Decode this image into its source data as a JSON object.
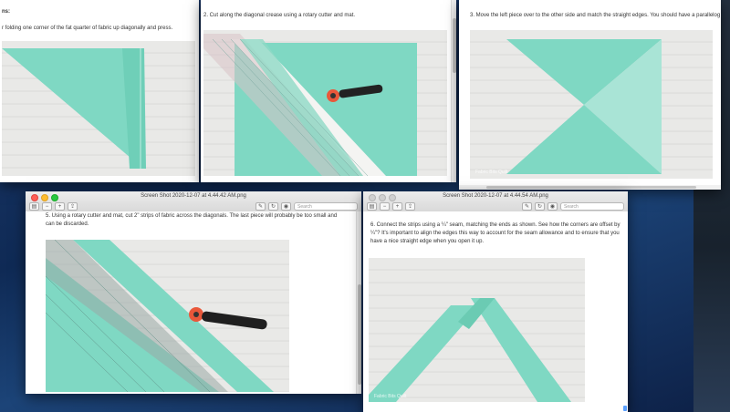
{
  "windows": {
    "w1": {
      "cap": "r folding one corner of the fat quarter of fabric up diagonally and press.",
      "head": "ns:"
    },
    "w2": {
      "cap": "2. Cut along the diagonal crease using a rotary cutter and mat."
    },
    "w3": {
      "cap": "3. Move the left piece over to the other side and match the straight edges. You should have a parallelog",
      "wm": "Fabric Bits Quilt"
    },
    "w4": {
      "title": "Screen Shot 2020-12-07 at 4.44.42 AM.png",
      "cap": "5. Using a rotary cutter and mat, cut 2\" strips of fabric across the diagonals. The last piece will probably be too small and can be discarded.",
      "search": "Search"
    },
    "w5": {
      "title": "Screen Shot 2020-12-07 at 4.44.54 AM.png",
      "cap": "6. Connect the strips using a ¼\" seam, matching the ends as shown. See how the corners are offset by ¼\"? It's important to align the edges this way to account for the seam allowance and to ensure that you have a nice straight edge when you open it up.",
      "search": "Search",
      "wm": "Fabric Bits Quilt"
    }
  },
  "colors": {
    "fabric": "#7fd8c3",
    "fabric_dark": "#68c9b2",
    "cutter_knob": "#e9573a"
  }
}
